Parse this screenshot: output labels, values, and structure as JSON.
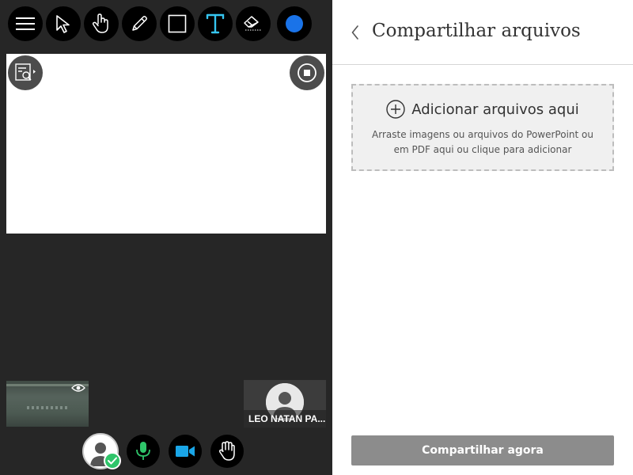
{
  "toolbar": {
    "tools": [
      {
        "name": "menu-icon"
      },
      {
        "name": "select-arrow-icon"
      },
      {
        "name": "hand-pan-icon"
      },
      {
        "name": "pencil-icon"
      },
      {
        "name": "rectangle-icon"
      },
      {
        "name": "text-tool-icon"
      },
      {
        "name": "eraser-icon"
      },
      {
        "name": "color-picker-icon"
      }
    ],
    "active_color": "#1a73e8",
    "text_tool_color": "#36c5f0"
  },
  "participant": {
    "name": "LEO NATAN PA..."
  },
  "controls": {
    "mic_color": "#2fc56a",
    "camera_color": "#1aa6e8"
  },
  "panel": {
    "title": "Compartilhar arquivos",
    "dropzone": {
      "title": "Adicionar arquivos aqui",
      "description": "Arraste imagens ou arquivos do PowerPoint ou em PDF aqui ou clique para adicionar"
    },
    "share_button": "Compartilhar agora"
  }
}
